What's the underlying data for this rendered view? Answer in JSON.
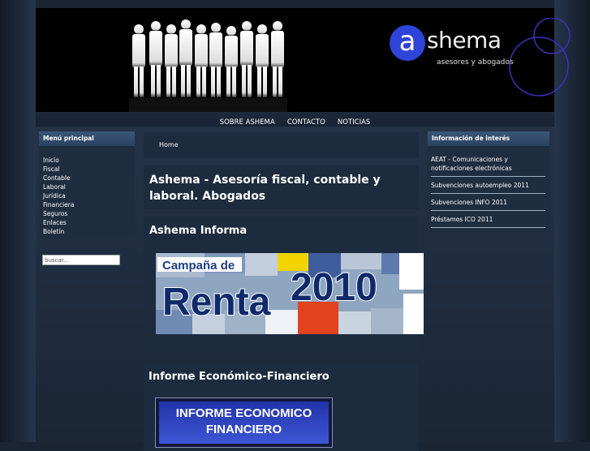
{
  "header": {
    "logo_letter": "a",
    "logo_word": "shema",
    "logo_tagline": "asesores y abogados",
    "logo_color": "#2f44d8"
  },
  "nav": {
    "items": [
      "SOBRE ASHEMA",
      "CONTACTO",
      "NOTICIAS"
    ]
  },
  "menu": {
    "title": "Menú principal",
    "items": [
      "Inicio",
      "Fiscal",
      "Contable",
      "Laboral",
      "Jurídica",
      "Financiera",
      "Seguros",
      "Enlaces",
      "Boletín"
    ]
  },
  "search": {
    "value": "buscar..."
  },
  "info": {
    "title": "Información de interés",
    "items": [
      "AEAT - Comunicaciones y notificaciones electrónicas",
      "Subvenciones autoempleo 2011",
      "Subvenciones INFO 2011",
      "Préstamos ICO 2011"
    ]
  },
  "breadcrumb": {
    "home": "Home"
  },
  "main": {
    "page_title": "Ashema - Asesoría fiscal, contable y laboral. Abogados",
    "section1_title": "Ashema Informa",
    "banner1_line1": "Campaña de",
    "banner1_word": "Renta",
    "banner1_year": "2010",
    "section2_title": "Informe Económico-Financiero",
    "banner2_line1": "INFORME ECONOMICO",
    "banner2_line2": "FINANCIERO"
  }
}
